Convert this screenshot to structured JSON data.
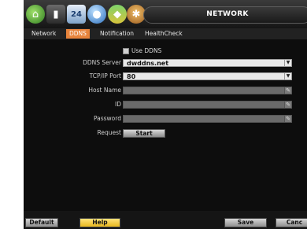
{
  "title": "NETWORK",
  "toolbar": {
    "icons": [
      "network-icon",
      "record-icon",
      "calendar-icon",
      "display-icon",
      "camera-icon",
      "tools-icon"
    ],
    "calendar_day": "24"
  },
  "tabs": [
    {
      "label": "Network",
      "active": false
    },
    {
      "label": "DDNS",
      "active": true
    },
    {
      "label": "Notification",
      "active": false
    },
    {
      "label": "HealthCheck",
      "active": false
    }
  ],
  "form": {
    "use_ddns_label": "Use DDNS",
    "use_ddns_checked": false,
    "ddns_server_label": "DDNS Server",
    "ddns_server_value": "dwddns.net",
    "tcp_port_label": "TCP/IP Port",
    "tcp_port_value": "80",
    "host_name_label": "Host Name",
    "id_label": "ID",
    "password_label": "Password",
    "request_label": "Request",
    "start_button": "Start"
  },
  "footer": {
    "default_button": "Default",
    "help_button": "Help",
    "save_button": "Save",
    "cancel_button": "Canc"
  },
  "colors": {
    "active_tab": "#e8843c",
    "help_button": "#f2c94c",
    "background": "#0b0b0b"
  }
}
